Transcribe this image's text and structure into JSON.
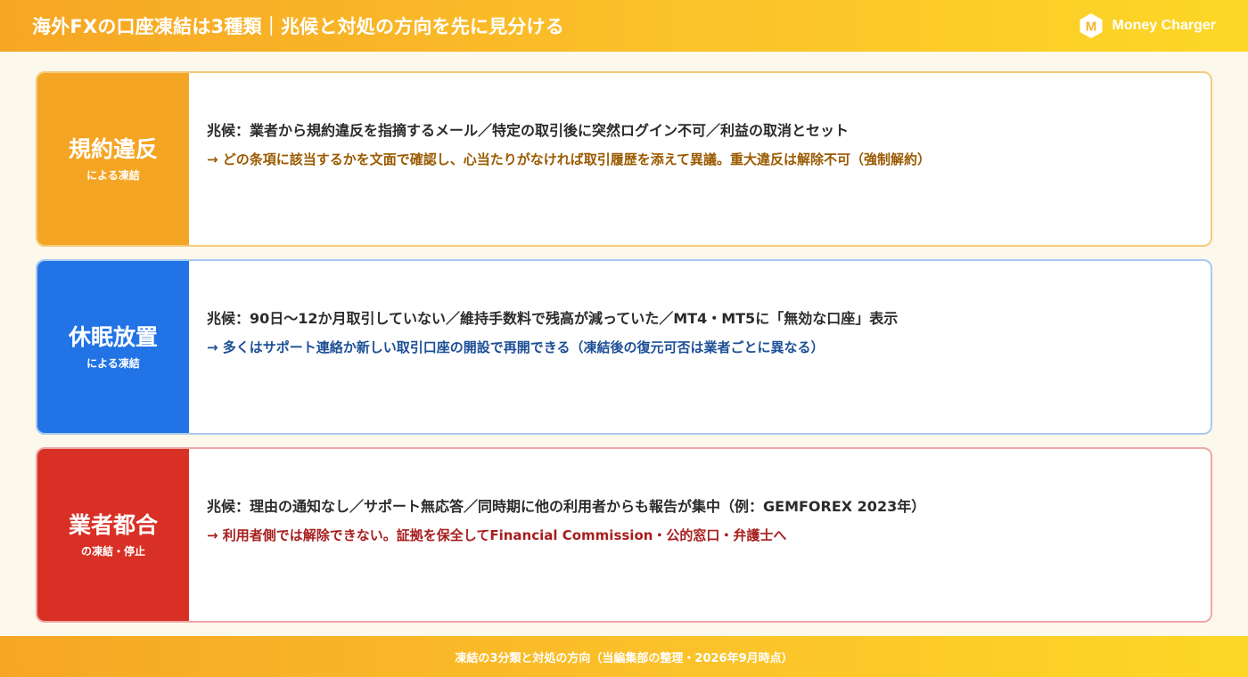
{
  "header": {
    "title": "海外FXの口座凍結は3種類｜兆候と対処の方向を先に見分ける",
    "brand_logo_letter": "M",
    "brand_name": "Money Charger"
  },
  "cards": [
    {
      "color": "#f5a524",
      "title": "規約違反",
      "subtitle": "による凍結",
      "sign": "兆候：業者から規約違反を指摘するメール／特定の取引後に突然ログイン不可／利益の取消とセット",
      "action": "→ どの条項に該当するかを文面で確認し、心当たりがなければ取引履歴を添えて異議。重大違反は解除不可（強制解約）"
    },
    {
      "color": "#2273e5",
      "title": "休眠放置",
      "subtitle": "による凍結",
      "sign": "兆候：90日〜12か月取引していない／維持手数料で残高が減っていた／MT4・MT5に「無効な口座」表示",
      "action": "→ 多くはサポート連絡か新しい取引口座の開設で再開できる（凍結後の復元可否は業者ごとに異なる）"
    },
    {
      "color": "#d93026",
      "title": "業者都合",
      "subtitle": "の凍結・停止",
      "sign": "兆候：理由の通知なし／サポート無応答／同時期に他の利用者からも報告が集中（例：GEMFOREX 2023年）",
      "action": "→ 利用者側では解除できない。証拠を保全してFinancial Commission・公的窓口・弁護士へ"
    }
  ],
  "footer": {
    "text": "凍結の3分類と対処の方向（当編集部の整理・2026年9月時点）"
  }
}
